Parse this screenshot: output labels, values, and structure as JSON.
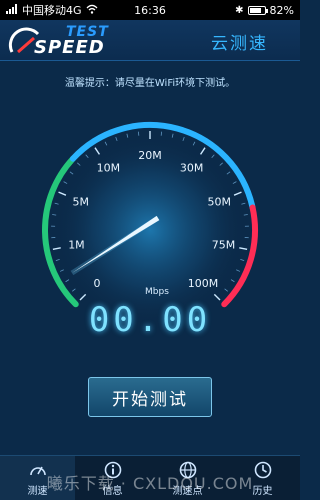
{
  "status_bar": {
    "carrier": "中国移动4G",
    "time": "16:36",
    "battery": "82%",
    "battery_level": 0.82
  },
  "header": {
    "logo_test": "TEST",
    "logo_speed": "SPEED",
    "title": "云测速"
  },
  "tip": "温馨提示：请尽量在WiFi环境下测试。",
  "gauge": {
    "unit": "Mbps",
    "ticks": [
      "0",
      "1M",
      "5M",
      "10M",
      "20M",
      "30M",
      "50M",
      "75M",
      "100M"
    ],
    "needle_value": 0,
    "colors": {
      "low": "#25c87a",
      "mid": "#2bb4ff",
      "high": "#ff2d55"
    }
  },
  "reading": "00.00",
  "start_button": "开始测试",
  "nav": [
    {
      "label": "测速",
      "icon": "speedometer-icon"
    },
    {
      "label": "信息",
      "icon": "info-icon"
    },
    {
      "label": "测速点",
      "icon": "globe-icon"
    },
    {
      "label": "历史",
      "icon": "history-icon"
    }
  ],
  "watermark": "曦乐下载 · CXLDOU.COM"
}
